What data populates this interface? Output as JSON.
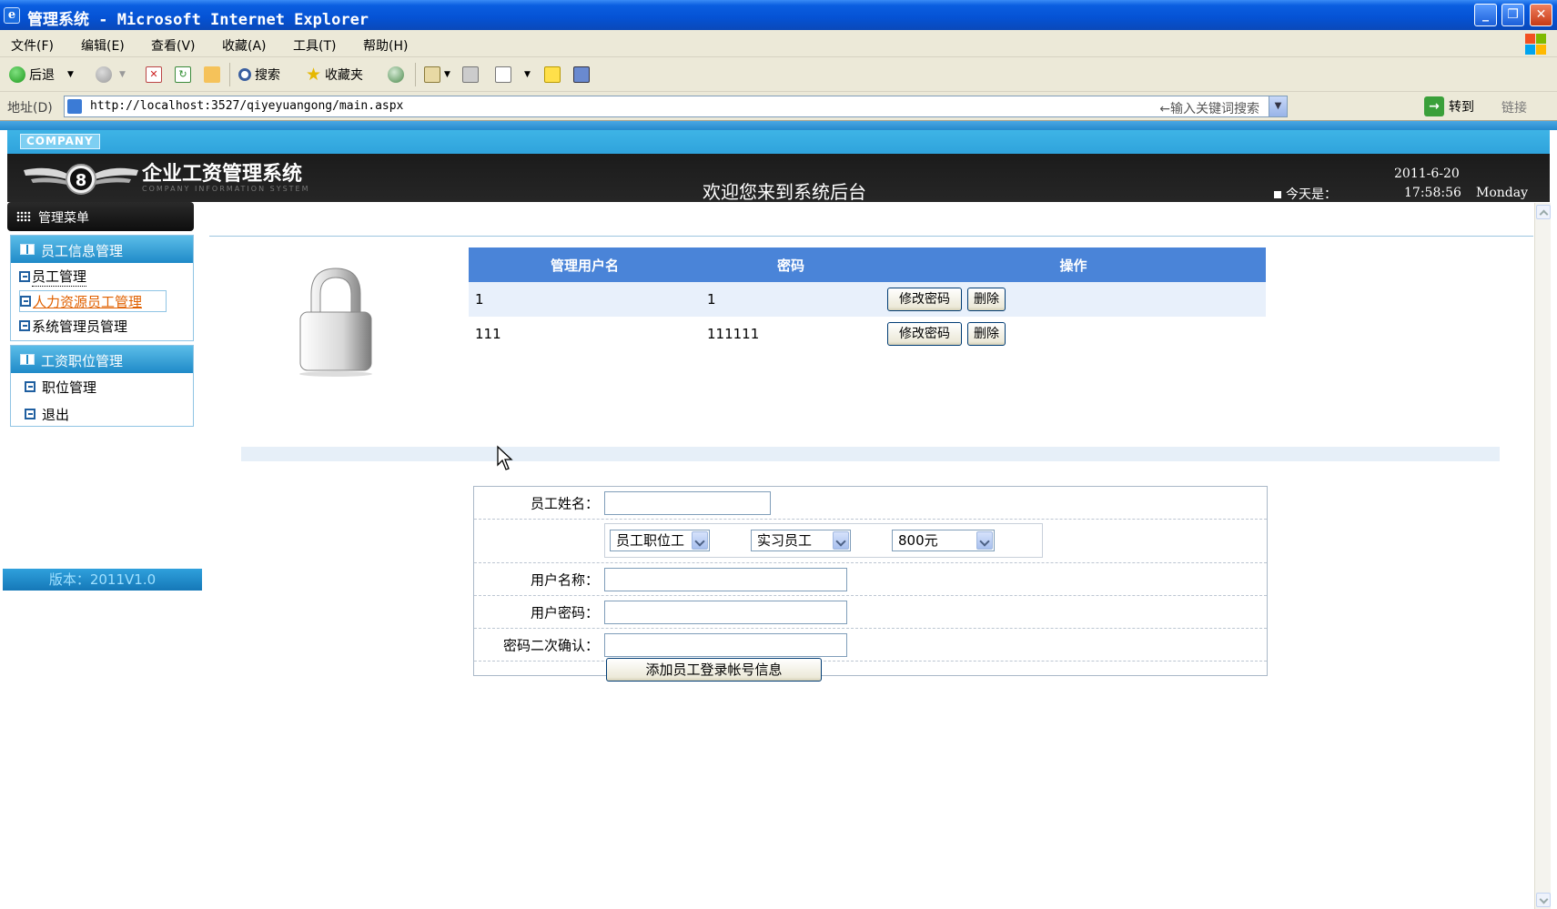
{
  "window": {
    "title": "管理系统 - Microsoft Internet Explorer",
    "minimize": "_",
    "maximize": "❐",
    "close": "✕"
  },
  "menubar": [
    "文件(F)",
    "编辑(E)",
    "查看(V)",
    "收藏(A)",
    "工具(T)",
    "帮助(H)"
  ],
  "toolbar": {
    "back_label": "后退",
    "search_label": "搜索",
    "favorites_label": "收藏夹"
  },
  "address": {
    "label": "地址(D)",
    "url": "http://localhost:3527/qiyeyuangong/main.aspx",
    "keyword_placeholder": "←输入关键词搜索",
    "go_label": "转到",
    "links_label": "链接"
  },
  "header": {
    "company_badge": "COMPANY",
    "system_name": "企业工资管理系统",
    "system_name_en": "COMPANY INFORMATION SYSTEM",
    "welcome": "欢迎您来到系统后台",
    "today_label": "今天是：",
    "date": "2011-6-20",
    "time": "17:58:56",
    "weekday": "Monday"
  },
  "sidebar": {
    "menu_title": "管理菜单",
    "groups": [
      {
        "title": "员工信息管理",
        "items": [
          {
            "label": "员工管理"
          },
          {
            "label": "人力资源员工管理"
          },
          {
            "label": "系统管理员管理"
          }
        ]
      },
      {
        "title": "工资职位管理",
        "items": [
          {
            "label": "职位管理"
          },
          {
            "label": "退出"
          }
        ]
      }
    ],
    "version": "版本：2011V1.0"
  },
  "admin_table": {
    "headers": [
      "管理用户名",
      "密码",
      "操作"
    ],
    "rows": [
      {
        "username": "1",
        "password": "1"
      },
      {
        "username": "111",
        "password": "111111"
      }
    ],
    "change_pwd_label": "修改密码",
    "delete_label": "删除"
  },
  "form": {
    "name_label": "员工姓名：",
    "position_select": "员工职位工",
    "type_select": "实习员工",
    "salary_select": "800元",
    "username_label": "用户名称：",
    "password_label": "用户密码：",
    "confirm_label": "密码二次确认：",
    "submit_label": "添加员工登录帐号信息"
  },
  "colors": {
    "titlebar": "#0552d4",
    "table_header": "#4a84d8",
    "sidebar_header": "#1f8ac8",
    "active_link": "#e06000"
  }
}
